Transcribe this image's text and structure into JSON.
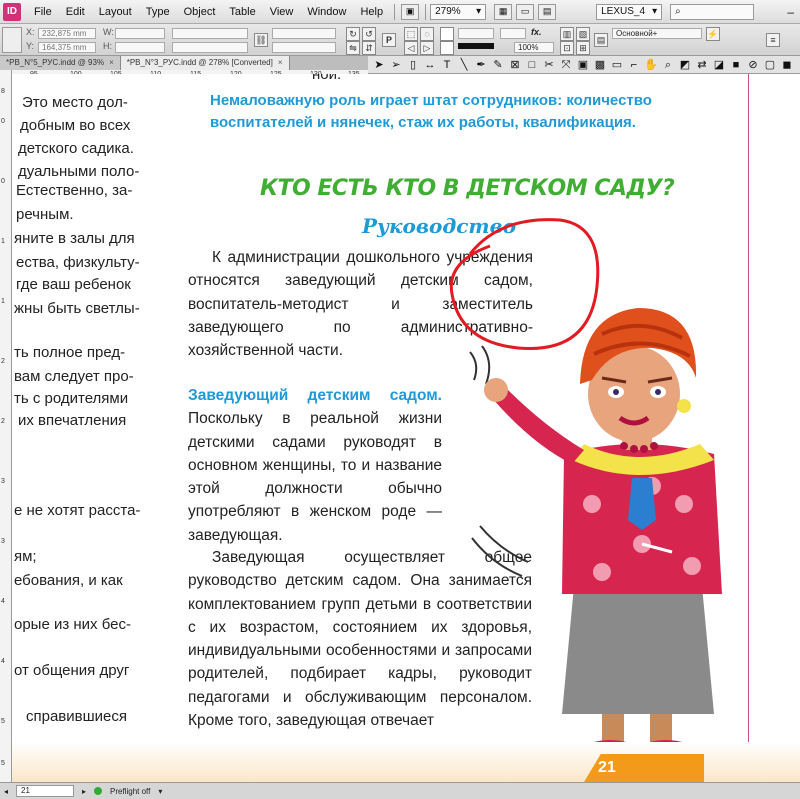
{
  "app": {
    "logo": "ID",
    "menus": [
      "File",
      "Edit",
      "Layout",
      "Type",
      "Object",
      "Table",
      "View",
      "Window",
      "Help"
    ],
    "zoom": "279%",
    "workspace": "LEXUS_4"
  },
  "control_panel": {
    "x_label": "X:",
    "x_value": "232,875 mm",
    "y_label": "Y:",
    "y_value": "164,375 mm",
    "w_label": "W:",
    "h_label": "H:",
    "stroke_percent": "100%",
    "style_value": "Основной+",
    "fx_label": "fx."
  },
  "tabs": [
    {
      "label": "*PB_N°5_РУС.indd @ 93%",
      "close": "×"
    },
    {
      "label": "*PB_N°3_РУС.indd @ 278% [Converted]",
      "close": "×"
    }
  ],
  "ruler": {
    "top_labels": [
      "95",
      "100",
      "105",
      "110",
      "115",
      "120",
      "125",
      "130",
      "135"
    ],
    "left_labels": [
      "8",
      "0",
      "0",
      "1",
      "1",
      "2",
      "2",
      "3",
      "3",
      "4",
      "4",
      "5",
      "5"
    ]
  },
  "left_column": [
    "Это место дол-",
    "добным во всех",
    "детского садика.",
    "дуальными поло-",
    "Естественно, за-",
    "речным.",
    "яните в залы для",
    "ества, физкульту-",
    "где ваш ребенок",
    "жны быть светлы-",
    "ть полное пред-",
    "вам следует про-",
    "ть с родителями",
    "их впечатления",
    "е не хотят расста-",
    "ям;",
    "ебования, и как",
    "орые из них бес-",
    "от общения друг",
    "справившиеся"
  ],
  "page": {
    "top_fragment": "нои.",
    "intro": "Немаловажную роль играет штат сотрудников: количество воспитателей и нянечек, стаж их работы, квалификация.",
    "heading_main": "КТО ЕСТЬ КТО В ДЕТСКОМ САДУ?",
    "heading_sub": "Руководство",
    "paragraph1": "К администрации дошкольного учреждения относятся заведующий детским садом, воспитатель-методист и заместитель заведующего по административно-хозяйственной части.",
    "para2_highlight": "Заведующий детским садом.",
    "para2_text": " Поскольку в реальной жизни детскими садами руководят в основном женщины, то и название этой должности обычно употребляют в женском роде — заведующая.",
    "paragraph3": "Заведующая осуществляет общее руководство детским садом. Она занимается комплектованием групп детьми в соответствии с их возрастом, состоянием их здоровья, индивидуальными особенностями и запросами родителей, подбирает кадры, руководит педагогами и обслуживающим персоналом. Кроме того, заведующая отвечает",
    "page_number": "21"
  },
  "status_bar": {
    "page_field": "21",
    "preflight": "Preflight off"
  },
  "colors": {
    "accent_blue": "#1e9ad6",
    "heading_green": "#3fae33",
    "annotation_red": "#e21b23",
    "page_orange": "#f39a1a"
  }
}
